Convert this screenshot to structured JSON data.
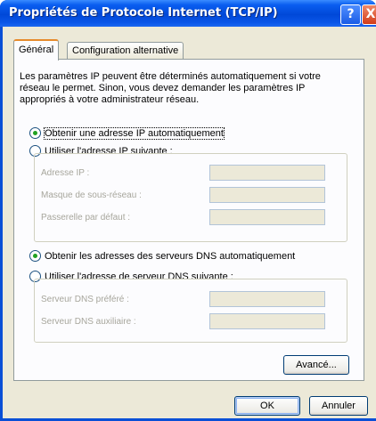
{
  "window": {
    "title": "Propriétés de Protocole Internet (TCP/IP)",
    "help_label": "?",
    "close_label": "X"
  },
  "tabs": [
    {
      "label": "Général"
    },
    {
      "label": "Configuration alternative"
    }
  ],
  "intro_text": "Les paramètres IP peuvent être déterminés automatiquement si votre réseau le permet. Sinon, vous devez demander les paramètres IP appropriés à votre administrateur réseau.",
  "ip": {
    "auto_label": "Obtenir une adresse IP automatiquement",
    "manual_label": "Utiliser l'adresse IP suivante :",
    "selected": "auto",
    "fields": [
      {
        "label": "Adresse IP :",
        "value": ""
      },
      {
        "label": "Masque de sous-réseau :",
        "value": ""
      },
      {
        "label": "Passerelle par défaut :",
        "value": ""
      }
    ]
  },
  "dns": {
    "auto_label": "Obtenir les adresses des serveurs DNS automatiquement",
    "manual_label": "Utiliser l'adresse de serveur DNS suivante :",
    "selected": "auto",
    "fields": [
      {
        "label": "Serveur DNS préféré :",
        "value": ""
      },
      {
        "label": "Serveur DNS auxiliaire :",
        "value": ""
      }
    ]
  },
  "buttons": {
    "advanced": "Avancé...",
    "ok": "OK",
    "cancel": "Annuler"
  }
}
